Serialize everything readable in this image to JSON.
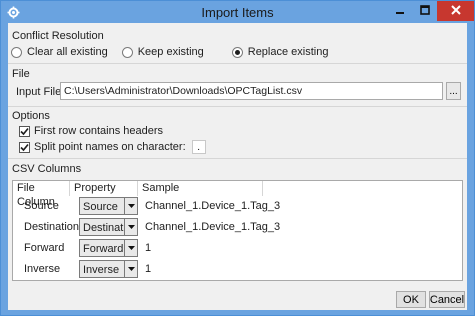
{
  "window": {
    "title": "Import Items",
    "icons": {
      "app": "gear-icon",
      "minimize": "minimize-icon",
      "maximize": "maximize-icon",
      "close": "close-icon"
    }
  },
  "conflict": {
    "label": "Conflict Resolution",
    "options": [
      "Clear all existing",
      "Keep existing",
      "Replace existing"
    ],
    "selected": "Replace existing"
  },
  "file": {
    "label": "File",
    "input_label": "Input File:",
    "path": "C:\\Users\\Administrator\\Downloads\\OPCTagList.csv",
    "browse_label": "..."
  },
  "options": {
    "label": "Options",
    "first_row_headers": {
      "label": "First row contains headers",
      "checked": true
    },
    "split_names": {
      "label": "Split point names on character:",
      "checked": true,
      "char": "."
    }
  },
  "csv": {
    "label": "CSV Columns",
    "headers": [
      "File Column",
      "Property",
      "Sample"
    ],
    "rows": [
      {
        "column": "Source",
        "property": "Source",
        "sample": "Channel_1.Device_1.Tag_3"
      },
      {
        "column": "Destination",
        "property": "Destination",
        "sample": "Channel_1.Device_1.Tag_3"
      },
      {
        "column": "Forward",
        "property": "Forward",
        "sample": "1"
      },
      {
        "column": "Inverse",
        "property": "Inverse",
        "sample": "1"
      }
    ]
  },
  "buttons": {
    "ok": "OK",
    "cancel": "Cancel"
  },
  "colors": {
    "titlebar": "#6aa3e0",
    "close": "#c7372f",
    "background": "#f0f0f0"
  }
}
